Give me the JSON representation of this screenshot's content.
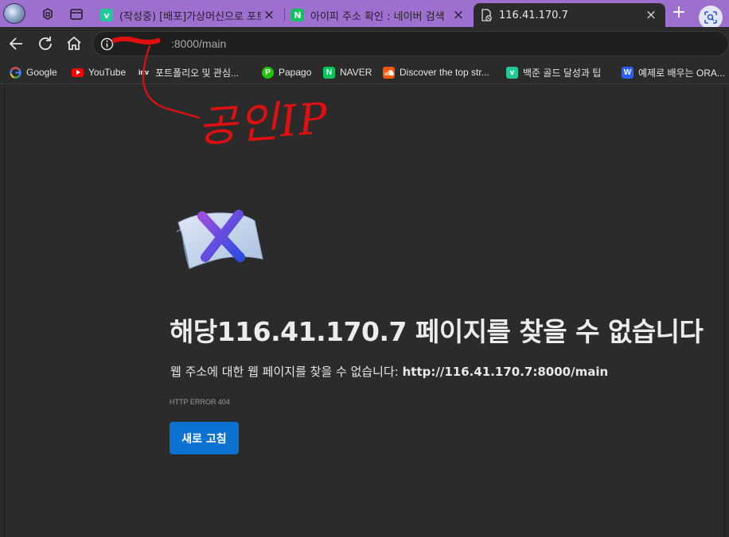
{
  "colors": {
    "tabstrip": "#9d6fcf",
    "page_background": "#2b2b2b",
    "reload_button": "#0b72d1",
    "annotation": "#e01010"
  },
  "tabs": [
    {
      "label": "(작성중) [배포]가상머신으로 포트",
      "favicon": "v-icon",
      "favicon_color": "#20c997"
    },
    {
      "label": "아이피 주소 확인 : 네이버 검색",
      "favicon": "naver-icon",
      "favicon_color": "#03c75a"
    },
    {
      "label": "116.41.170.7",
      "favicon": "page-error-icon",
      "active": true
    }
  ],
  "toolbar": {
    "url": ":8000/main"
  },
  "bookmarks": [
    {
      "label": "Google",
      "icon": "google-icon"
    },
    {
      "label": "YouTube",
      "icon": "youtube-icon"
    },
    {
      "label": "포트폴리오 및 관심...",
      "icon": "inv-icon"
    },
    {
      "label": "Papago",
      "icon": "papago-icon"
    },
    {
      "label": "NAVER",
      "icon": "naver-icon"
    },
    {
      "label": "Discover the top str...",
      "icon": "soundcloud-icon"
    },
    {
      "label": "백준 골드 달성과 팁",
      "icon": "v-icon"
    },
    {
      "label": "예제로 배우는 ORA...",
      "icon": "w-icon"
    }
  ],
  "error": {
    "title": "해당116.41.170.7 페이지를 찾을 수 없습니다",
    "description_prefix": "웹 주소에 대한 웹 페이지를 찾을 수 없습니다: ",
    "description_url": "http://116.41.170.7:8000/main",
    "code": "HTTP ERROR 404",
    "reload_label": "새로 고침"
  },
  "annotation": {
    "text": "공인IP"
  }
}
